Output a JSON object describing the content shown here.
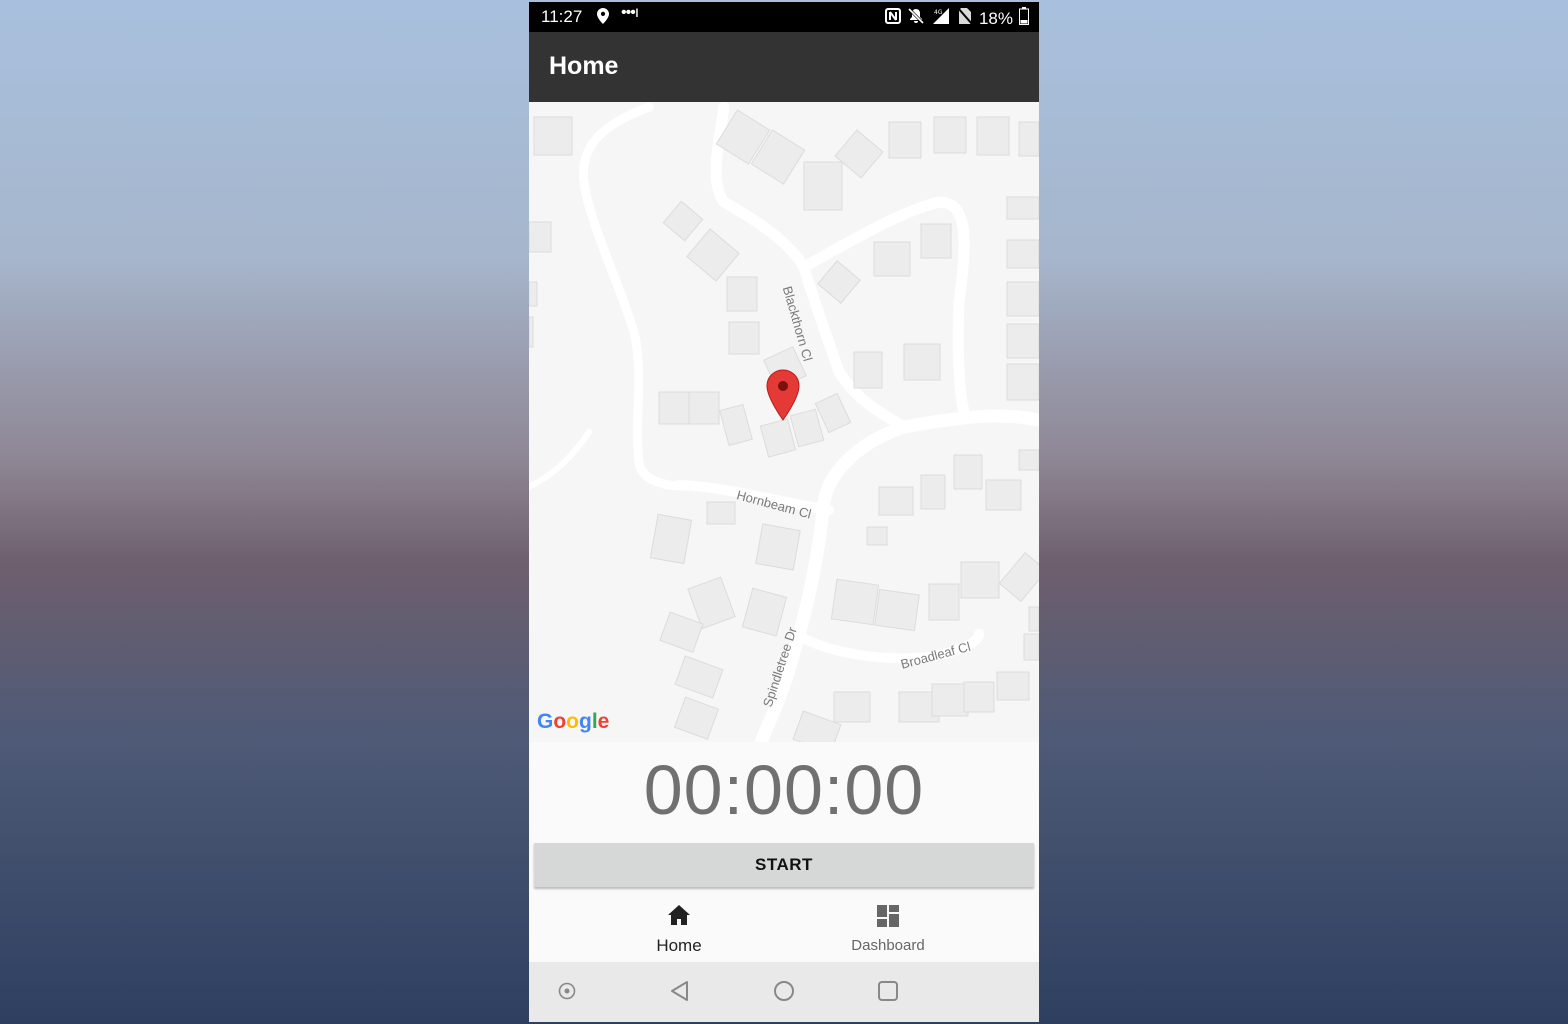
{
  "status_bar": {
    "time": "11:27",
    "dots": "•••ı",
    "battery_percent": "18%",
    "icons": [
      "location-icon",
      "nfc-icon",
      "mute-icon",
      "signal-icon",
      "no-sim-icon",
      "battery-icon"
    ]
  },
  "app_bar": {
    "title": "Home"
  },
  "map": {
    "streets": [
      "Blackthorn Cl",
      "Hornbeam Cl",
      "Spindletree Dr",
      "Broadleaf Cl"
    ],
    "logo": "Google",
    "marker_color": "#e53935"
  },
  "timer": {
    "value": "00:00:00"
  },
  "start_button": {
    "label": "START"
  },
  "bottom_nav": {
    "items": [
      {
        "label": "Home",
        "icon": "home-icon",
        "active": true
      },
      {
        "label": "Dashboard",
        "icon": "dashboard-icon",
        "active": false
      }
    ]
  },
  "system_nav": [
    "assistant-icon",
    "back-icon",
    "home-circle-icon",
    "recents-icon"
  ]
}
